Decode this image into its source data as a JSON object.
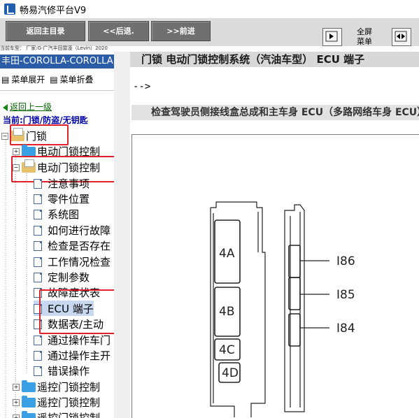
{
  "window": {
    "title": "畅易汽修平台V9"
  },
  "toolbar": {
    "back_main": "返回主目录",
    "back": "<<后退.",
    "forward": ">>前进",
    "fullscreen_line1": "全屏",
    "fullscreen_line2": "菜单"
  },
  "vehicle_line": "当前车型： 厂家:G-广汽丰田雷凌（Levin）2020",
  "sidebar": {
    "header": "丰田-COROLLA-COROLLA",
    "menu_expand": "菜单展开",
    "menu_collapse": "菜单折叠",
    "back_up": "返回上一级",
    "current": "当前:门锁/防盗/无钥匙",
    "tree": {
      "root": "门锁",
      "node1": "电动门锁控制",
      "node2": "电动门锁控制",
      "children": [
        "注意事项",
        "零件位置",
        "系统图",
        "如何进行故障",
        "检查是否存在",
        "工作情况检查",
        "定制参数",
        "故障症状表",
        "ECU 端子",
        "数据表/主动",
        "通过操作车门",
        "通过操作主开",
        "错误操作"
      ],
      "after": [
        "遥控门锁控制",
        "遥控门锁控制",
        "遥控门锁控制"
      ]
    }
  },
  "main": {
    "title": "门锁  电动门锁控制系统（汽油车型）  ECU 端子",
    "arrow": "-->",
    "subheader": "检查驾驶员侧接线盒总成和主车身 ECU（多路网络车身 ECU）",
    "connectors": [
      "4A",
      "4B",
      "4C",
      "4D"
    ],
    "pins": [
      "I86",
      "I85",
      "I84"
    ]
  },
  "colors": {
    "sidebar_header": "#2a5ca8",
    "highlight": "#e0202a",
    "toolbar_button": "#707070"
  }
}
